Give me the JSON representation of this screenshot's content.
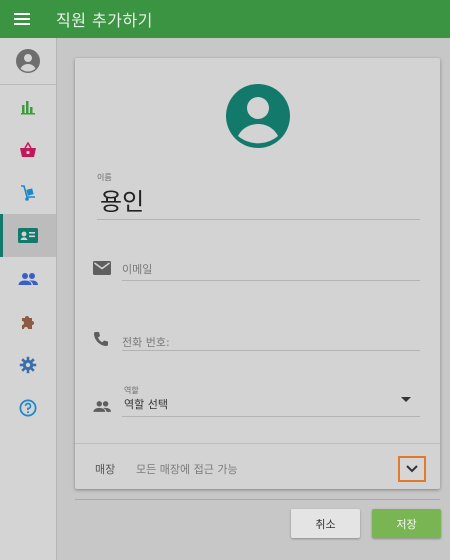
{
  "app_bar": {
    "title": "직원 추가하기",
    "menu_icon": "menu-icon",
    "color": "#3b9441"
  },
  "sidebar": {
    "avatar_icon": "account-circle-icon",
    "items": [
      {
        "icon": "bar-chart-icon",
        "color": "#3d9a3d",
        "active": false
      },
      {
        "icon": "shopping-basket-icon",
        "color": "#c2185b",
        "active": false
      },
      {
        "icon": "hand-truck-icon",
        "color": "#1e88c8",
        "active": false
      },
      {
        "icon": "contact-card-icon",
        "color": "#137a6b",
        "active": true
      },
      {
        "icon": "people-icon",
        "color": "#3a5ec9",
        "active": false
      },
      {
        "icon": "puzzle-icon",
        "color": "#8d5a43",
        "active": false
      },
      {
        "icon": "settings-icon",
        "color": "#3a6cae",
        "active": false
      },
      {
        "icon": "help-icon",
        "color": "#1e88c8",
        "active": false
      }
    ]
  },
  "form": {
    "avatar_icon": "account-circle-icon",
    "avatar_color": "#137a6b",
    "name_label": "이름",
    "name_value": "용인",
    "email_placeholder": "이메일",
    "phone_placeholder": "전화 번호:",
    "role_label": "역할",
    "role_value": "역할 선택",
    "store_label": "매장",
    "store_value": "모든 매장에 접근 가능"
  },
  "buttons": {
    "cancel": "취소",
    "save": "저장",
    "save_color": "#7ab553"
  }
}
